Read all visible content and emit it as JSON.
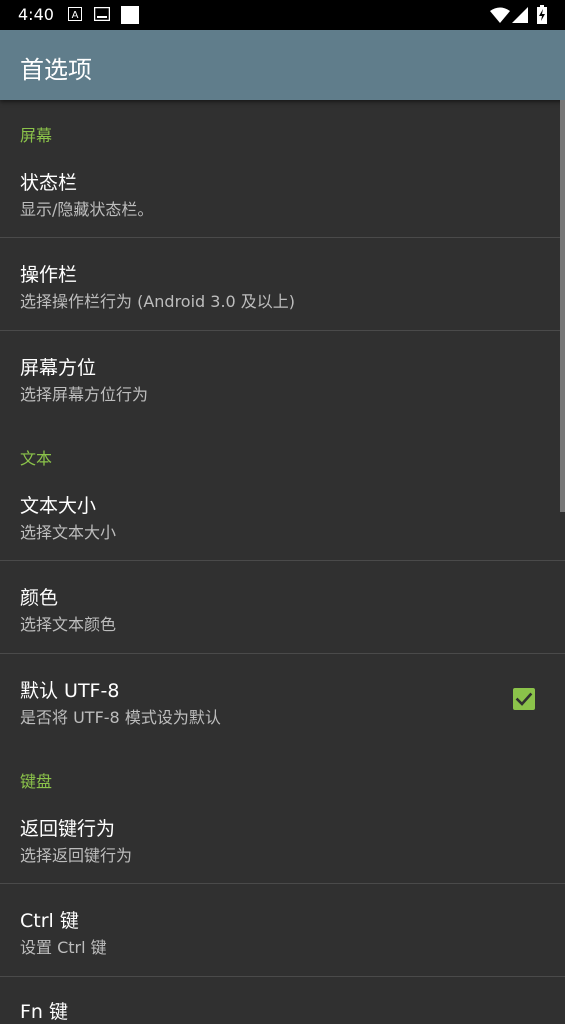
{
  "status_bar": {
    "time": "4:40"
  },
  "app_bar": {
    "title": "首选项"
  },
  "categories": {
    "screen": "屏幕",
    "text": "文本",
    "keyboard": "键盘"
  },
  "items": {
    "statusbar": {
      "title": "状态栏",
      "summary": "显示/隐藏状态栏。"
    },
    "actionbar": {
      "title": "操作栏",
      "summary": "选择操作栏行为 (Android 3.0 及以上)"
    },
    "orientation": {
      "title": "屏幕方位",
      "summary": "选择屏幕方位行为"
    },
    "textsize": {
      "title": "文本大小",
      "summary": "选择文本大小"
    },
    "color": {
      "title": "颜色",
      "summary": "选择文本颜色"
    },
    "utf8": {
      "title": "默认 UTF-8",
      "summary": "是否将 UTF-8 模式设为默认",
      "checked": true
    },
    "backkey": {
      "title": "返回键行为",
      "summary": "选择返回键行为"
    },
    "ctrlkey": {
      "title": "Ctrl 键",
      "summary": "设置 Ctrl 键"
    },
    "fnkey": {
      "title": "Fn 键"
    }
  },
  "colors": {
    "accent": "#8bc34a",
    "appbar": "#607d8b",
    "background": "#303030"
  }
}
